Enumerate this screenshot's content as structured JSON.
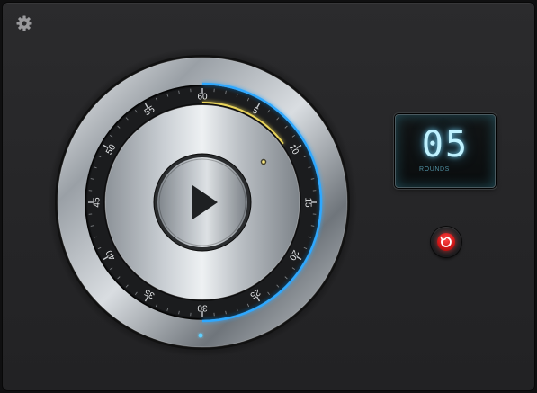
{
  "toolbar": {
    "settings_icon": "gear-icon"
  },
  "dial": {
    "scale_labels": [
      "60",
      "5",
      "10",
      "15",
      "20",
      "25",
      "30",
      "35",
      "40",
      "45",
      "50",
      "55"
    ],
    "active_range_start": 60,
    "elapsed_end": 9,
    "center_icon": "play-icon",
    "accent_color": "#2fa8ff",
    "elapsed_color": "#e8d35a"
  },
  "rounds_display": {
    "value": "05",
    "label": "ROUNDS"
  },
  "reset_button": {
    "icon": "reset-icon",
    "color": "#e02020"
  }
}
